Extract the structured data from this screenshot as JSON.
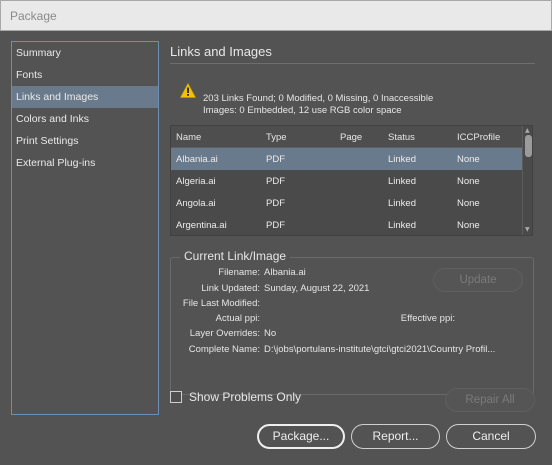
{
  "window": {
    "title": "Package"
  },
  "sidebar": {
    "items": [
      {
        "label": "Summary"
      },
      {
        "label": "Fonts"
      },
      {
        "label": "Links and Images"
      },
      {
        "label": "Colors and Inks"
      },
      {
        "label": "Print Settings"
      },
      {
        "label": "External Plug-ins"
      }
    ],
    "selected": "Links and Images"
  },
  "main": {
    "section_title": "Links and Images",
    "summary_line1": "203 Links Found; 0 Modified, 0 Missing, 0 Inaccessible",
    "summary_line2": "Images: 0 Embedded, 12 use RGB color space",
    "table": {
      "columns": [
        "Name",
        "Type",
        "Page",
        "Status",
        "ICCProfile"
      ],
      "rows": [
        {
          "name": "Albania.ai",
          "type": "PDF",
          "page": "",
          "status": "Linked",
          "icc": "None"
        },
        {
          "name": "Algeria.ai",
          "type": "PDF",
          "page": "",
          "status": "Linked",
          "icc": "None"
        },
        {
          "name": "Angola.ai",
          "type": "PDF",
          "page": "",
          "status": "Linked",
          "icc": "None"
        },
        {
          "name": "Argentina.ai",
          "type": "PDF",
          "page": "",
          "status": "Linked",
          "icc": "None"
        }
      ]
    },
    "current": {
      "title": "Current Link/Image",
      "filename_label": "Filename:",
      "filename": "Albania.ai",
      "link_updated_label": "Link Updated:",
      "link_updated": "Sunday, August 22, 2021",
      "file_last_modified_label": "File Last Modified:",
      "file_last_modified": "",
      "actual_ppi_label": "Actual ppi:",
      "actual_ppi": "",
      "effective_ppi_label": "Effective ppi:",
      "effective_ppi": "",
      "layer_overrides_label": "Layer Overrides:",
      "layer_overrides": "No",
      "complete_name_label": "Complete Name:",
      "complete_name": "D:\\jobs\\portulans-institute\\gtci\\gtci2021\\Country Profil...",
      "update_label": "Update"
    },
    "show_problems_label": "Show Problems Only",
    "show_problems_checked": false,
    "repair_all_label": "Repair All"
  },
  "footer": {
    "package_label": "Package...",
    "report_label": "Report...",
    "cancel_label": "Cancel"
  },
  "colors": {
    "background": "#535353",
    "selection": "#6a7a8d",
    "sidebar_border": "#6a8fb3",
    "warning": "#f2c200"
  }
}
